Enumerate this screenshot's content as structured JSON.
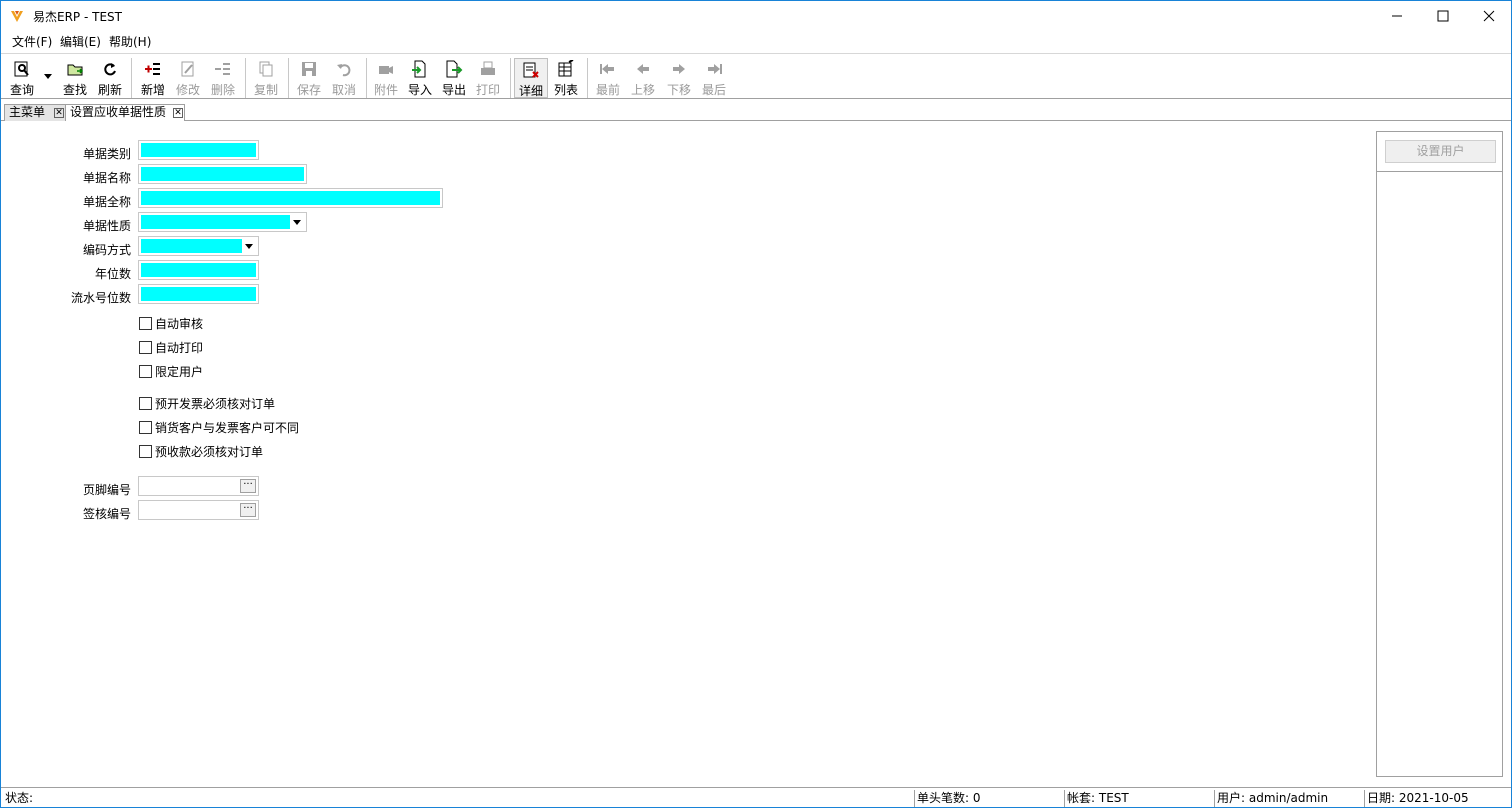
{
  "window": {
    "title": "易杰ERP - TEST",
    "controls": {
      "minimize": "─",
      "maximize": "☐",
      "close": "✕"
    }
  },
  "menu": [
    {
      "label": "文件(F)"
    },
    {
      "label": "编辑(E)"
    },
    {
      "label": "帮助(H)"
    }
  ],
  "toolbar": {
    "query": "查询",
    "find": "查找",
    "refresh": "刷新",
    "add": "新增",
    "modify": "修改",
    "delete": "删除",
    "copy": "复制",
    "save": "保存",
    "cancel": "取消",
    "attach": "附件",
    "import": "导入",
    "export": "导出",
    "print": "打印",
    "detail": "详细",
    "list": "列表",
    "first": "最前",
    "prev": "上移",
    "next": "下移",
    "last": "最后"
  },
  "tabs": [
    {
      "label": "主菜单"
    },
    {
      "label": "设置应收单据性质"
    }
  ],
  "form": {
    "doc_type_label": "单据类别",
    "doc_name_label": "单据名称",
    "doc_fullname_label": "单据全称",
    "doc_nature_label": "单据性质",
    "code_method_label": "编码方式",
    "year_digits_label": "年位数",
    "serial_digits_label": "流水号位数",
    "auto_audit": "自动审核",
    "auto_print": "自动打印",
    "restrict_users": "限定用户",
    "prepay_invoice_check": "预开发票必须核对订单",
    "sales_invoice_customer_diff": "销货客户与发票客户可不同",
    "advance_receipt_check": "预收款必须核对订单",
    "footer_code_label": "页脚编号",
    "approval_code_label": "签核编号"
  },
  "right_panel": {
    "set_users_button": "设置用户"
  },
  "status": {
    "status_label": "状态:",
    "header_count": "单头笔数: 0",
    "account": "帐套: TEST",
    "user": "用户: admin/admin",
    "date": "日期: 2021-10-05"
  },
  "colors": {
    "required_field": "#00ffff",
    "title_border": "#1883d7"
  }
}
